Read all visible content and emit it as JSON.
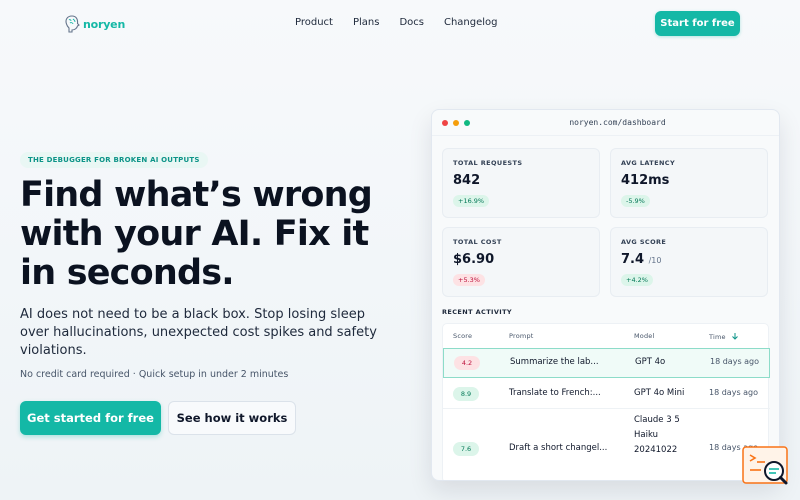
{
  "nav": {
    "brand": "noryen",
    "links": [
      "Product",
      "Plans",
      "Docs",
      "Changelog"
    ],
    "cta": "Start for free"
  },
  "hero": {
    "eyebrow": "THE DEBUGGER FOR BROKEN AI OUTPUTS",
    "headline": "Find what’s wrong with your AI. Fix it in seconds.",
    "subcopy": "AI does not need to be a black box. Stop losing sleep over hallucinations, unexpected cost spikes and safety violations.",
    "note": "No credit card required · Quick setup in under 2 minutes",
    "primary_cta": "Get started for free",
    "secondary_cta": "See how it works"
  },
  "dashboard": {
    "url": "noryen.com/dashboard",
    "stats": [
      {
        "label": "TOTAL REQUESTS",
        "value": "842",
        "unit": "",
        "delta": "+16.9%",
        "trend": "up"
      },
      {
        "label": "AVG LATENCY",
        "value": "412ms",
        "unit": "",
        "delta": "-5.9%",
        "trend": "up"
      },
      {
        "label": "TOTAL COST",
        "value": "$6.90",
        "unit": "",
        "delta": "+5.3%",
        "trend": "down"
      },
      {
        "label": "AVG SCORE",
        "value": "7.4",
        "unit": "/10",
        "delta": "+4.2%",
        "trend": "up"
      }
    ],
    "activity_label": "RECENT ACTIVITY",
    "columns": [
      "Score",
      "Prompt",
      "Model",
      "Time"
    ],
    "rows": [
      {
        "score": "4.2",
        "prompt": "Summarize the lab...",
        "model": "GPT 4o",
        "time": "18 days ago",
        "quality": "bad"
      },
      {
        "score": "8.9",
        "prompt": "Translate to French:...",
        "model": "GPT 4o Mini",
        "time": "18 days ago",
        "quality": "good"
      },
      {
        "score": "7.6",
        "prompt": "Draft a short changel...",
        "model_lines": [
          "Claude 3 5",
          "Haiku",
          "20241022"
        ],
        "time": "18 days ago",
        "quality": "good"
      }
    ]
  },
  "colors": {
    "accent": "#14b8a6",
    "good": "#047857",
    "bad": "#be123c"
  },
  "icons": [
    "brain-logo-icon",
    "sort-arrow-down-icon",
    "chat-search-widget-icon"
  ]
}
